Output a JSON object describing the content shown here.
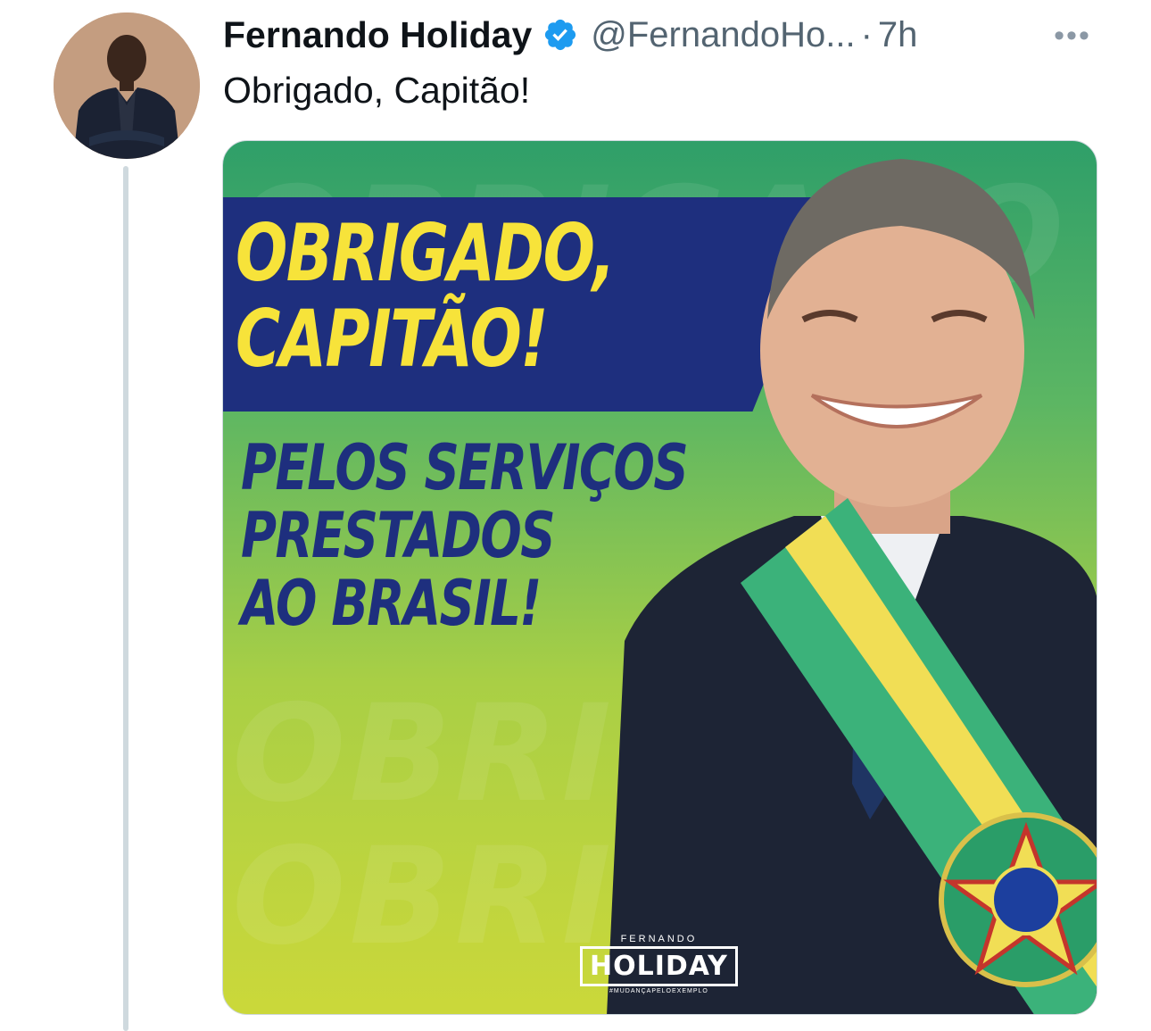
{
  "tweet": {
    "display_name": "Fernando Holiday",
    "handle": "@FernandoHo...",
    "separator": "·",
    "time": "7h",
    "more_icon": "ellipsis-icon",
    "verified_icon": "verified-badge-icon",
    "text": "Obrigado, Capitão!"
  },
  "media": {
    "headline_line1": "OBRIGADO,",
    "headline_line2": "CAPITÃO!",
    "subhead_line1": "PELOS SERVIÇOS",
    "subhead_line2": "PRESTADOS",
    "subhead_line3": "AO BRASIL!",
    "logo_top": "FERNANDO",
    "logo_main": "HOLIDAY",
    "logo_sub": "#MUDANÇAPELOEXEMPLO",
    "watermark": "OBRIGADO"
  },
  "colors": {
    "accent_blue": "#1d9bf0",
    "banner_navy": "#1e2f7e",
    "banner_yellow": "#f7e33a",
    "flag_green": "#3bb27a"
  }
}
